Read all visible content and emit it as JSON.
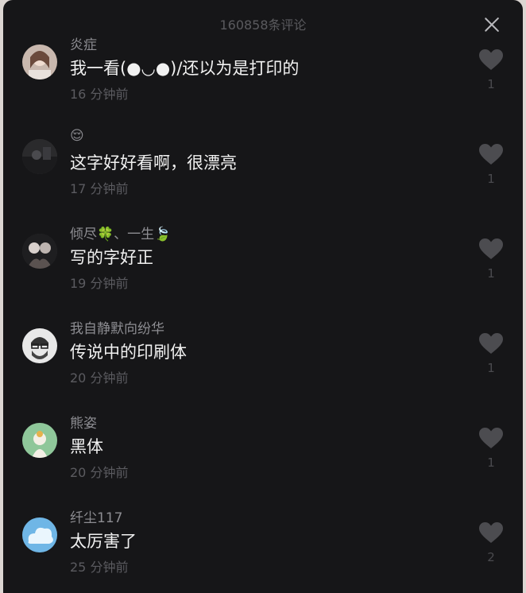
{
  "header": {
    "title": "160858条评论"
  },
  "comments": [
    {
      "name": "炎症",
      "text": "我一看(●◡●)/还以为是打印的",
      "time": "16 分钟前",
      "likes": "1",
      "avatar": "avatar-girl"
    },
    {
      "name": "😌",
      "text": "这字好好看啊，很漂亮",
      "time": "17 分钟前",
      "likes": "1",
      "avatar": "avatar-dark"
    },
    {
      "name": "倾尽🍀、一生🍃",
      "text": "写的字好正",
      "time": "19 分钟前",
      "likes": "1",
      "avatar": "avatar-couple"
    },
    {
      "name": "我自静默向纷华",
      "text": "传说中的印刷体",
      "time": "20 分钟前",
      "likes": "1",
      "avatar": "avatar-bearded"
    },
    {
      "name": "熊姿",
      "text": "黑体",
      "time": "20 分钟前",
      "likes": "1",
      "avatar": "avatar-green"
    },
    {
      "name": "纤尘117",
      "text": "太厉害了",
      "time": "25 分钟前",
      "likes": "2",
      "avatar": "avatar-cloud"
    }
  ],
  "colors": {
    "panel": "#161618",
    "text": "#f1f1f1",
    "muted": "#8d8d92",
    "heart": "#4c4c50"
  }
}
